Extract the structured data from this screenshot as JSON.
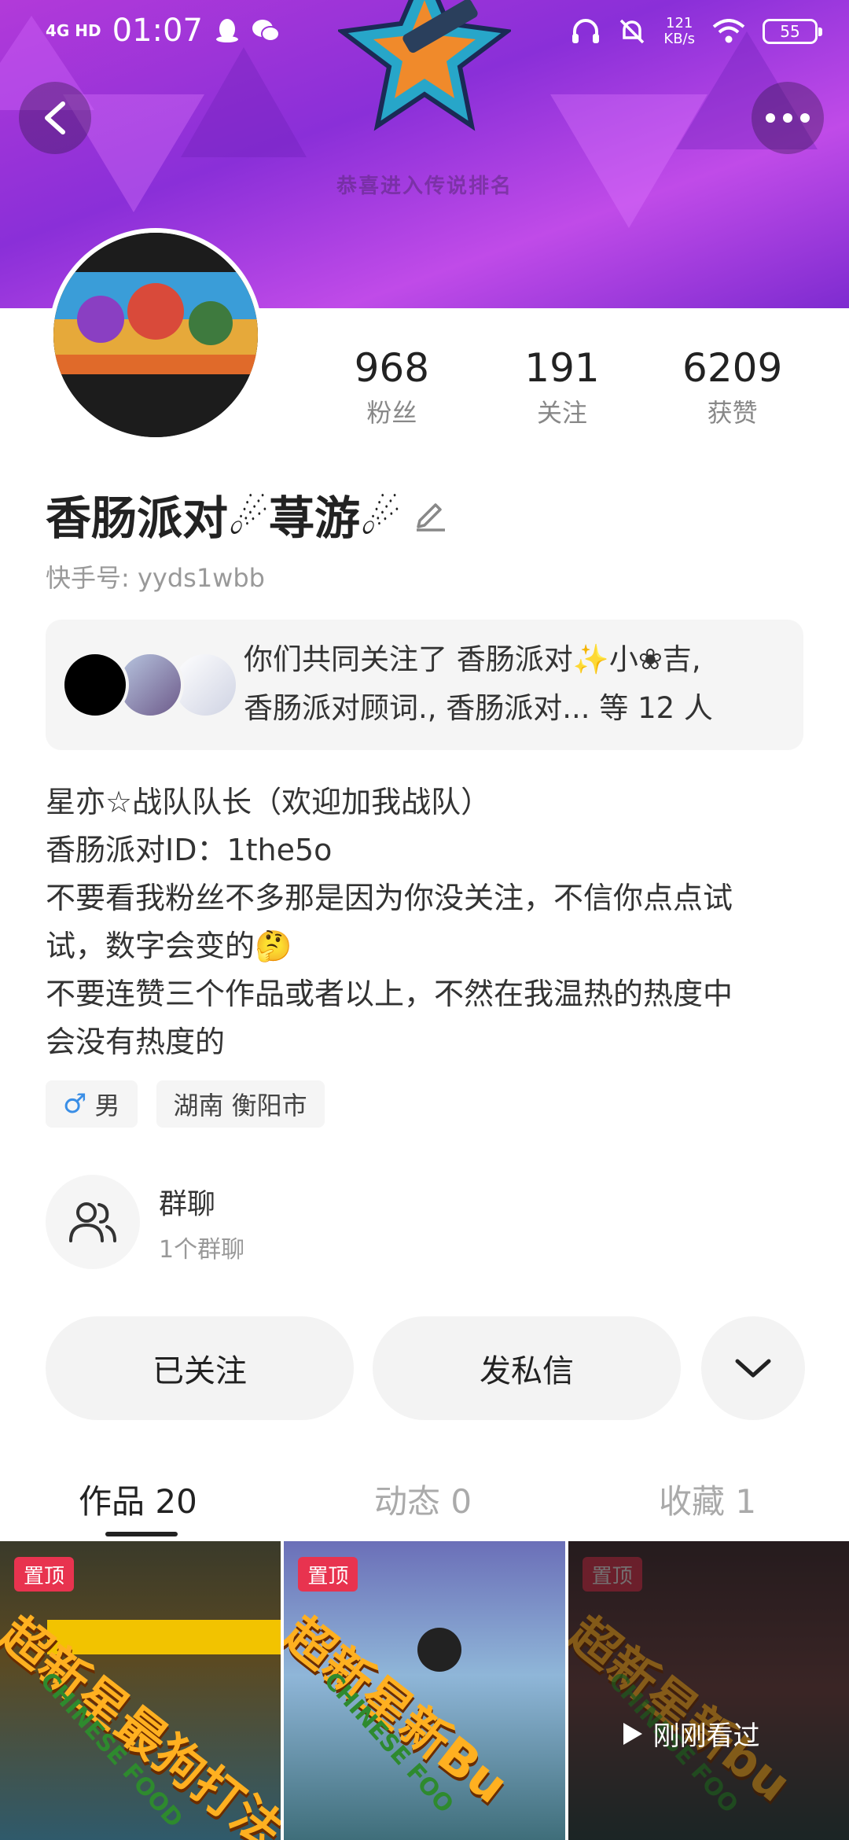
{
  "status_bar": {
    "network": "4G HD",
    "time": "01:07",
    "speed_value": "121",
    "speed_unit": "KB/s",
    "battery": "55"
  },
  "banner": {
    "caption": "恭喜进入传说排名"
  },
  "profile": {
    "name": "香肠派对☄荨游☄",
    "kuaishou_id": "快手号: yyds1wbb",
    "stats": [
      {
        "value": "968",
        "label": "粉丝"
      },
      {
        "value": "191",
        "label": "关注"
      },
      {
        "value": "6209",
        "label": "获赞"
      }
    ]
  },
  "mutual": {
    "line1": "你们共同关注了 香肠派对✨小❀吉,",
    "line2": "香肠派对顾词., 香肠派对... 等 12 人"
  },
  "bio": {
    "lines": [
      "星亦☆战队队长（欢迎加我战队）",
      "香肠派对ID：1the5o",
      "不要看我粉丝不多那是因为你没关注，不信你点点试",
      "试，数字会变的🤔",
      "不要连赞三个作品或者以上，不然在我温热的热度中",
      "会没有热度的"
    ]
  },
  "tags": {
    "gender_symbol": "♂",
    "gender": "男",
    "location": "湖南 衡阳市"
  },
  "group_chat": {
    "title": "群聊",
    "subtitle": "1个群聊"
  },
  "actions": {
    "following": "已关注",
    "message": "发私信"
  },
  "tabs": [
    {
      "label": "作品 20"
    },
    {
      "label": "动态 0"
    },
    {
      "label": "收藏 1"
    }
  ],
  "videos": [
    {
      "pin": "置顶",
      "title": "超新星最狗打法",
      "sub": "CHINESE FOOD"
    },
    {
      "pin": "置顶",
      "title": "超新星新Bu",
      "sub": "CHINESE FOO"
    },
    {
      "pin": "置顶",
      "title": "超新星新bu",
      "sub": "CHINESE FOO",
      "watched": "刚刚看过"
    }
  ],
  "colors": {
    "banner": "#9b34d8",
    "pin": "#e8334f",
    "gender_blue": "#3a8ee6"
  }
}
